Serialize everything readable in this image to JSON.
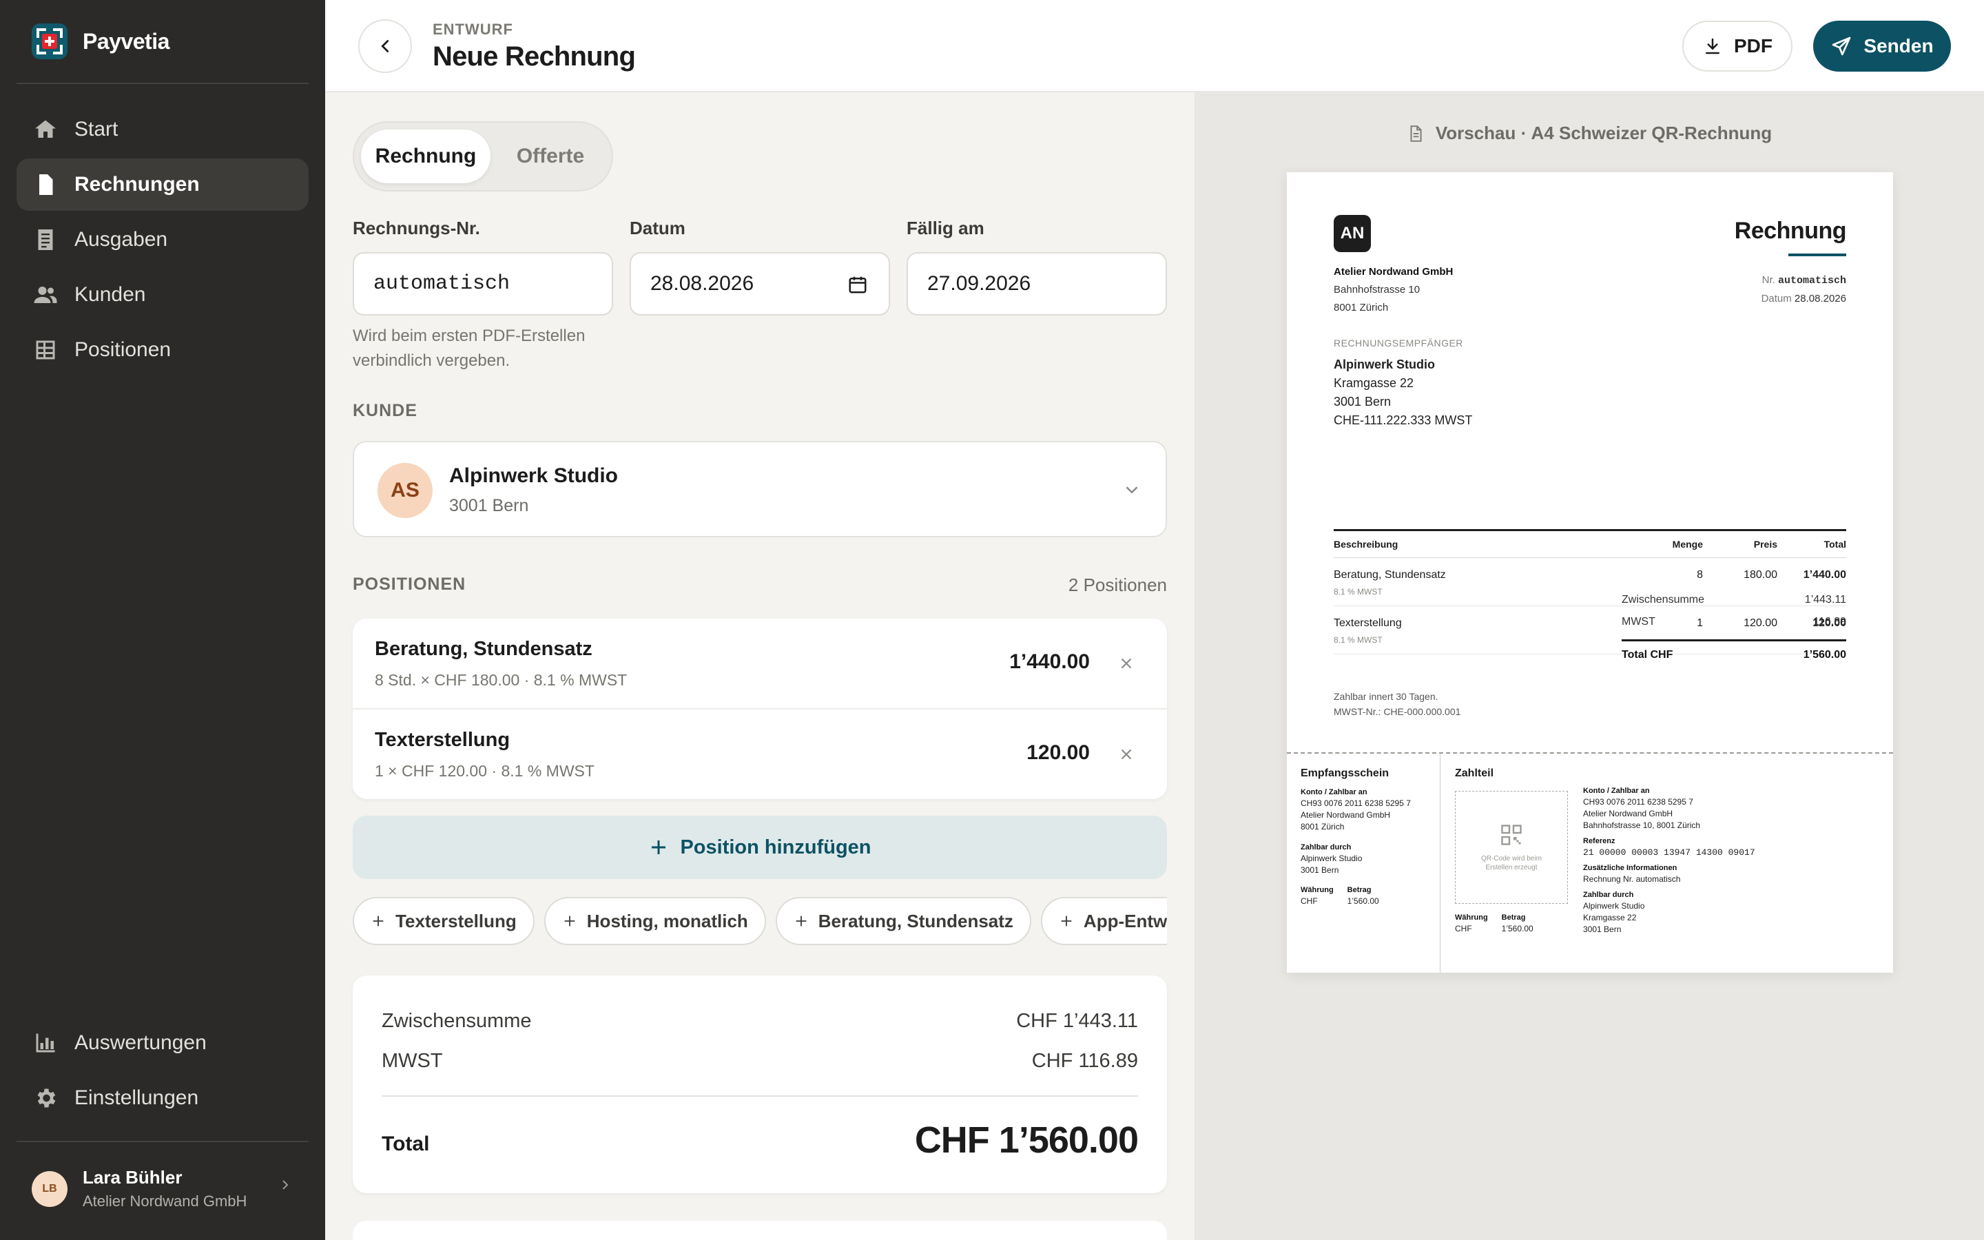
{
  "app": {
    "name": "Payvetia"
  },
  "sidebar": {
    "nav": [
      {
        "label": "Start",
        "icon": "home-icon"
      },
      {
        "label": "Rechnungen",
        "icon": "document-icon",
        "active": true
      },
      {
        "label": "Ausgaben",
        "icon": "receipt-icon"
      },
      {
        "label": "Kunden",
        "icon": "users-icon"
      },
      {
        "label": "Positionen",
        "icon": "table-icon"
      }
    ],
    "bottom_nav": [
      {
        "label": "Auswertungen",
        "icon": "bar-chart-icon"
      },
      {
        "label": "Einstellungen",
        "icon": "gear-icon"
      }
    ],
    "user": {
      "initials": "LB",
      "name": "Lara Bühler",
      "org": "Atelier Nordwand GmbH"
    }
  },
  "header": {
    "eyebrow": "ENTWURF",
    "title": "Neue Rechnung",
    "pdf_label": "PDF",
    "send_label": "Senden"
  },
  "form": {
    "tabs": [
      {
        "label": "Rechnung",
        "active": true
      },
      {
        "label": "Offerte",
        "active": false
      }
    ],
    "invoice_no": {
      "label": "Rechnungs-Nr.",
      "value": "automatisch",
      "hint": "Wird beim ersten PDF-Erstellen verbindlich vergeben."
    },
    "date": {
      "label": "Datum",
      "value": "28.08.2026"
    },
    "due": {
      "label": "Fällig am",
      "value": "27.09.2026"
    },
    "customer_section": "KUNDE",
    "customer": {
      "initials": "AS",
      "name": "Alpinwerk Studio",
      "city": "3001 Bern"
    },
    "positions_section": "POSITIONEN",
    "positions_count": "2 Positionen",
    "positions": [
      {
        "name": "Beratung, Stundensatz",
        "meta": "8 Std. × CHF 180.00 · 8.1 % MWST",
        "amount": "1’440.00"
      },
      {
        "name": "Texterstellung",
        "meta": "1 × CHF 120.00 · 8.1 % MWST",
        "amount": "120.00"
      }
    ],
    "add_position_label": "Position hinzufügen",
    "quick_chips": [
      "Texterstellung",
      "Hosting, monatlich",
      "Beratung, Stundensatz",
      "App-Entwicklung"
    ],
    "totals": {
      "subtotal_label": "Zwischensumme",
      "subtotal_value": "CHF 1’443.11",
      "vat_label": "MWST",
      "vat_value": "CHF 116.89",
      "total_label": "Total",
      "total_value": "CHF 1’560.00"
    }
  },
  "preview": {
    "caption": "Vorschau · A4 Schweizer QR-Rechnung",
    "logo_initials": "AN",
    "sender": {
      "name": "Atelier Nordwand GmbH",
      "street": "Bahnhofstrasse 10",
      "city": "8001 Zürich"
    },
    "doc_title": "Rechnung",
    "meta": {
      "nr_label": "Nr.",
      "nr_value": "automatisch",
      "date_label": "Datum",
      "date_value": "28.08.2026"
    },
    "recipient_label": "RECHNUNGSEMPFÄNGER",
    "recipient": {
      "name": "Alpinwerk Studio",
      "street": "Kramgasse 22",
      "city": "3001 Bern",
      "vat": "CHE-111.222.333 MWST"
    },
    "table_headers": {
      "desc": "Beschreibung",
      "qty": "Menge",
      "price": "Preis",
      "total": "Total"
    },
    "rows": [
      {
        "desc": "Beratung, Stundensatz",
        "vat": "8.1 % MWST",
        "qty": "8",
        "price": "180.00",
        "total": "1’440.00"
      },
      {
        "desc": "Texterstellung",
        "vat": "8.1 % MWST",
        "qty": "1",
        "price": "120.00",
        "total": "120.00"
      }
    ],
    "sums": {
      "subtotal_label": "Zwischensumme",
      "subtotal_value": "1’443.11",
      "vat_label": "MWST",
      "vat_value": "116.89",
      "total_label": "Total CHF",
      "total_value": "1’560.00"
    },
    "note_terms": "Zahlbar innert 30 Tagen.",
    "note_vat": "MWST-Nr.: CHE-000.000.001",
    "slip": {
      "receipt_title": "Empfangsschein",
      "payment_title": "Zahlteil",
      "account_label": "Konto / Zahlbar an",
      "iban": "CH93 0076 2011 6238 5295 7",
      "creditor_name": "Atelier Nordwand GmbH",
      "creditor_city": "8001 Zürich",
      "creditor_address_full": "Bahnhofstrasse 10, 8001 Zürich",
      "payable_by_label": "Zahlbar durch",
      "debtor_name": "Alpinwerk Studio",
      "debtor_street": "Kramgasse 22",
      "debtor_city": "3001 Bern",
      "currency_label": "Währung",
      "amount_label": "Betrag",
      "currency": "CHF",
      "amount": "1’560.00",
      "reference_label": "Referenz",
      "reference": "21 00000 00003 13947 14300 09017",
      "additional_label": "Zusätzliche Informationen",
      "additional": "Rechnung Nr. automatisch",
      "qr_placeholder": "QR-Code wird beim Erstellen erzeugt"
    }
  },
  "colors": {
    "accent": "#0d5264",
    "sidebar": "#2b2a28",
    "swiss_red": "#e4262d"
  }
}
